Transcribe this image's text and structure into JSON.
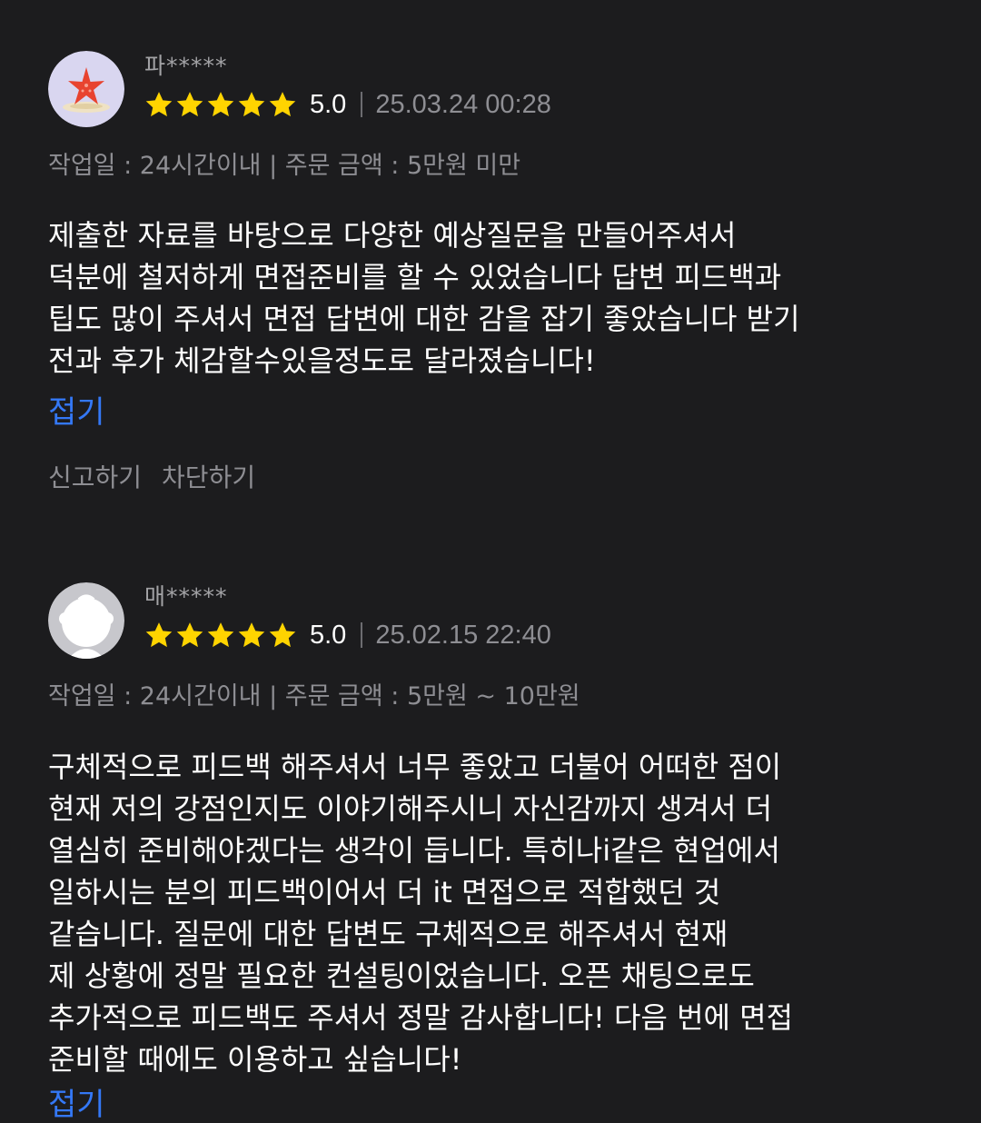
{
  "reviews": [
    {
      "user": "파*****",
      "avatar_icon": "starfish-avatar-icon",
      "rating": 5,
      "score_text": "5.0",
      "date": "25.03.24 00:28",
      "meta": "작업일 : 24시간이내 | 주문 금액 : 5만원 미만",
      "body_lines": [
        "제출한 자료를 바탕으로 다양한 예상질문을 만들어주셔서",
        "덕분에 철저하게 면접준비를 할 수 있었습니다 답변 피드백과",
        "팁도 많이 주셔서 면접 답변에 대한 감을 잡기 좋았습니다 받기",
        "전과 후가 체감할수있을정도로 달라졌습니다!"
      ],
      "collapse_label": "접기",
      "report_label": "신고하기",
      "block_label": "차단하기"
    },
    {
      "user": "매*****",
      "avatar_icon": "default-profile-avatar-icon",
      "rating": 5,
      "score_text": "5.0",
      "date": "25.02.15 22:40",
      "meta": "작업일 : 24시간이내 | 주문 금액 : 5만원 ~ 10만원",
      "body_lines": [
        "구체적으로 피드백 해주셔서 너무 좋았고 더불어 어떠한 점이",
        "현재 저의 강점인지도 이야기해주시니 자신감까지 생겨서 더",
        "열심히 준비해야겠다는 생각이 듭니다. 특히나i같은 현업에서",
        "일하시는 분의 피드백이어서 더 it 면접으로 적합했던 것",
        "같습니다. 질문에 대한 답변도 구체적으로 해주셔서 현재",
        "제 상황에 정말 필요한 컨설팅이었습니다. 오픈 채팅으로도",
        "추가적으로 피드백도 주셔서 정말 감사합니다! 다음 번에 면접",
        "준비할 때에도 이용하고 싶습니다!"
      ],
      "collapse_label": "접기"
    }
  ],
  "colors": {
    "background": "#1c1c1e",
    "star": "#ffd400",
    "link": "#3478f6",
    "muted": "#8e8e93"
  }
}
